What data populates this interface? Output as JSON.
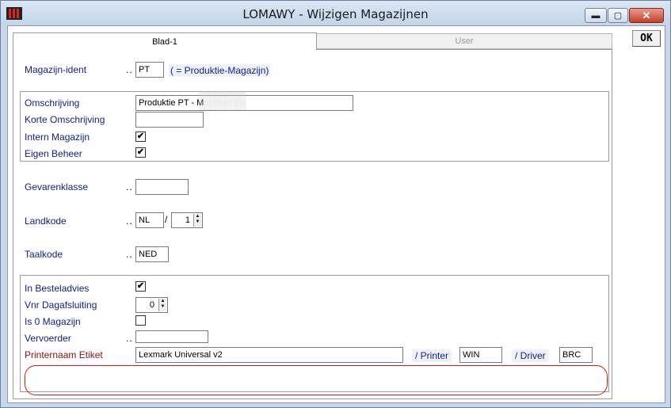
{
  "window": {
    "title": "LOMAWY - Wijzigen Magazijnen",
    "min_glyph": "▬",
    "max_glyph": "▢",
    "close_glyph": "✕"
  },
  "tabs": [
    {
      "label": "Blad-1",
      "active": true
    },
    {
      "label": "User",
      "active": false
    }
  ],
  "ok_label": "OK",
  "form": {
    "magazijn_ident": {
      "label": "Magazijn-ident",
      "dots": "..",
      "value": "PT",
      "description": "( =  Produktie-Magazijn)"
    },
    "omschrijving": {
      "label": "Omschrijving",
      "value": "Produktie PT - M"
    },
    "korte_omschrijving": {
      "label": "Korte Omschrijving",
      "value": ""
    },
    "intern_magazijn": {
      "label": "Intern Magazijn",
      "checked": true
    },
    "eigen_beheer": {
      "label": "Eigen Beheer",
      "checked": true
    },
    "gevarenklasse": {
      "label": "Gevarenklasse",
      "dots": "..",
      "value": ""
    },
    "landkode": {
      "label": "Landkode",
      "dots": "..",
      "value": "NL",
      "separator": "/",
      "number": "1"
    },
    "taalkode": {
      "label": "Taalkode",
      "dots": "..",
      "value": "NED"
    },
    "in_besteladvies": {
      "label": "In Besteladvies",
      "checked": true
    },
    "vnr_dagafsluiting": {
      "label": "Vnr Dagafsluiting",
      "value": "0"
    },
    "is_0_magazijn": {
      "label": "Is 0 Magazijn",
      "checked": false
    },
    "vervoerder": {
      "label": "Vervoerder",
      "dots": "..",
      "value": ""
    },
    "printernaam_etiket": {
      "label": "Printernaam Etiket",
      "value": "Lexmark Universal v2"
    },
    "printer": {
      "label": "/ Printer",
      "value": "WIN"
    },
    "driver": {
      "label": "/ Driver",
      "value": "BRC"
    }
  },
  "colors": {
    "label": "#10218b",
    "highlight": "#d11a1a",
    "frame": "#c9d7ea"
  }
}
